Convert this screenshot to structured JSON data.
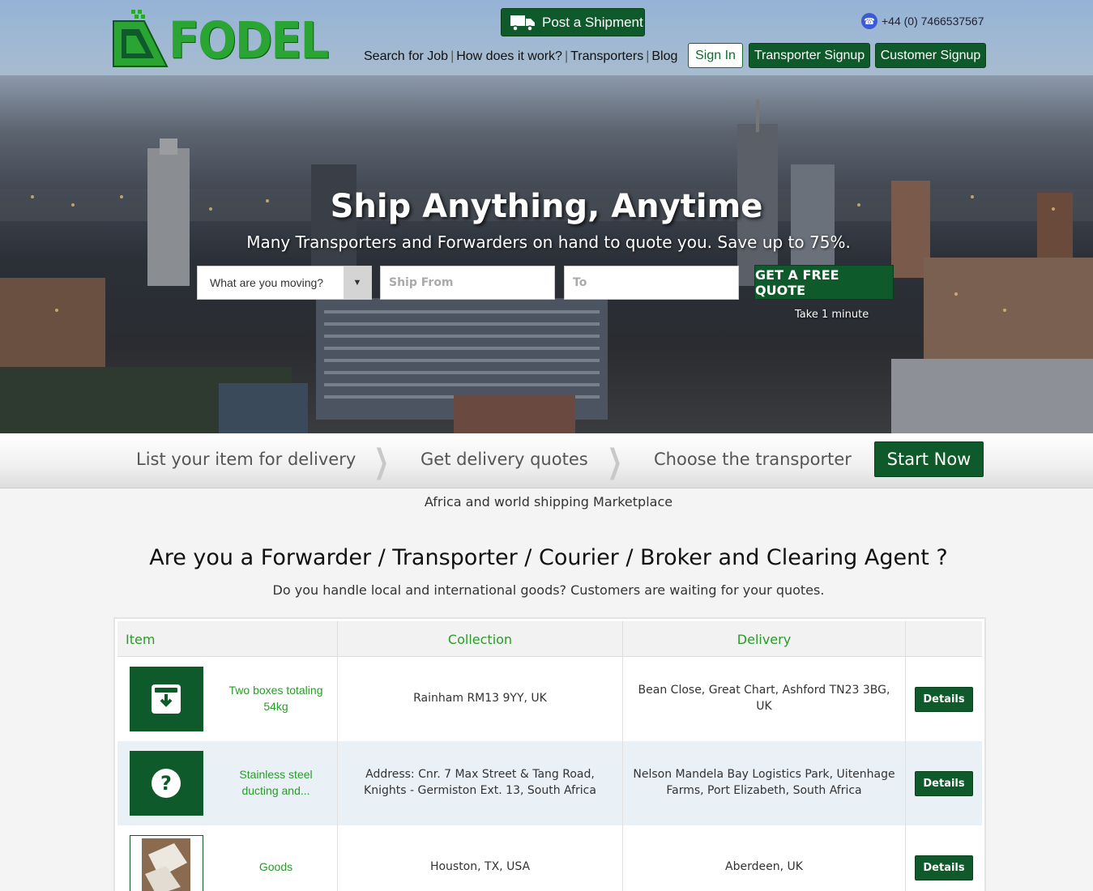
{
  "header": {
    "logo_text": "FODEL",
    "post_shipment": "Post a Shipment",
    "phone": "+44 (0) 7466537567",
    "nav": [
      "Search for Job",
      "How does it work?",
      "Transporters",
      "Blog"
    ],
    "sign_in": "Sign In",
    "transporter_signup": "Transporter Signup",
    "customer_signup": "Customer Signup"
  },
  "hero": {
    "title": "Ship Anything, Anytime",
    "subtitle": "Many Transporters and Forwarders on hand to quote you. Save up to 75%.",
    "moving_select": "What are you moving?",
    "from_placeholder": "Ship From",
    "to_placeholder": "To",
    "quote_button": "GET A FREE QUOTE",
    "quote_note": "Take 1 minute"
  },
  "steps": {
    "step1": "List your item for delivery",
    "step2": "Get delivery quotes",
    "step3": "Choose the transporter",
    "start": "Start Now"
  },
  "tagline": "Africa and world shipping Marketplace",
  "transporter_section": {
    "title": "Are you a Forwarder / Transporter / Courier / Broker and Clearing Agent ?",
    "subtitle": "Do you handle local and international goods? Customers are waiting for your quotes."
  },
  "jobs_table": {
    "headers": {
      "item": "Item",
      "collection": "Collection",
      "delivery": "Delivery"
    },
    "rows": [
      {
        "item": "Two boxes totaling 54kg",
        "collection": "Rainham RM13 9YY, UK",
        "delivery": "Bean Close, Great Chart, Ashford TN23 3BG, UK",
        "icon": "archive-box-icon",
        "button": "Details"
      },
      {
        "item": "Stainless steel ducting and...",
        "collection": "Address: Cnr. 7 Max Street & Tang Road, Knights - Germiston Ext. 13, South Africa",
        "delivery": "Nelson Mandela Bay Logistics Park, Uitenhage Farms, Port Elizabeth, South Africa",
        "icon": "question-icon",
        "button": "Details"
      },
      {
        "item": "Goods",
        "collection": "Houston, TX, USA",
        "delivery": "Aberdeen, UK",
        "icon": "goods-photo",
        "button": "Details"
      }
    ]
  },
  "colors": {
    "brand_green": "#0f5a2a",
    "accent_green": "#2a9a2a",
    "logo_green": "#2aa534"
  }
}
